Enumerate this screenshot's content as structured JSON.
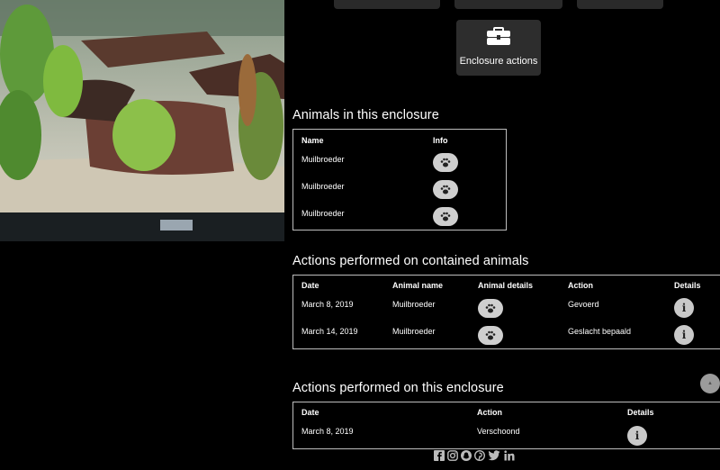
{
  "enclosure_button": {
    "label": "Enclosure actions",
    "icon": "briefcase-icon"
  },
  "animals": {
    "title": "Animals in this enclosure",
    "headers": [
      "Name",
      "Info"
    ],
    "rows": [
      {
        "name": "Muilbroeder"
      },
      {
        "name": "Muilbroeder"
      },
      {
        "name": "Muilbroeder"
      }
    ]
  },
  "animal_actions": {
    "title": "Actions performed on contained animals",
    "headers": [
      "Date",
      "Animal name",
      "Animal details",
      "Action",
      "Details"
    ],
    "rows": [
      {
        "date": "March 8, 2019",
        "animal": "Muilbroeder",
        "action": "Gevoerd"
      },
      {
        "date": "March 14, 2019",
        "animal": "Muilbroeder",
        "action": "Geslacht bepaald"
      }
    ]
  },
  "enclosure_actions": {
    "title": "Actions performed on this enclosure",
    "headers": [
      "Date",
      "Action",
      "Details"
    ],
    "rows": [
      {
        "date": "March 8, 2019",
        "action": "Verschoond"
      }
    ]
  },
  "social_icons": [
    "facebook-icon",
    "instagram-icon",
    "snapchat-icon",
    "pinterest-icon",
    "twitter-icon",
    "linkedin-icon"
  ],
  "colors": {
    "background": "#000000",
    "button": "#2d2d2d",
    "badge": "#cfcfcf"
  }
}
